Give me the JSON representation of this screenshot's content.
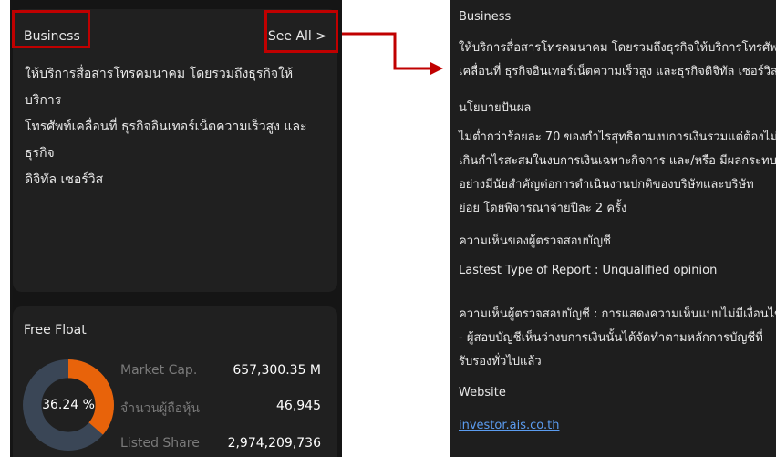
{
  "left": {
    "business": {
      "title": "Business",
      "see_all": "See All >",
      "description_lines": [
        "ให้บริการสื่อสารโทรคมนาคม โดยรวมถึงธุรกิจให้บริการ",
        "โทรศัพท์เคลื่อนที่ ธุรกิจอินเทอร์เน็ตความเร็วสูง และธุรกิจ",
        "ดิจิทัล เซอร์วิส"
      ]
    },
    "free_float": {
      "title": "Free Float",
      "percent_label": "36.24 %",
      "percent_value": 36.24,
      "stats": [
        {
          "label": "Market Cap.",
          "value": "657,300.35 M"
        },
        {
          "label": "จำนวนผู้ถือหุ้น",
          "value": "46,945"
        },
        {
          "label": "Listed Share",
          "value": "2,974,209,736"
        }
      ]
    }
  },
  "right": {
    "business_heading": "Business",
    "business_lines": [
      "ให้บริการสื่อสารโทรคมนาคม โดยรวมถึงธุรกิจให้บริการโทรศัพท์",
      "เคลื่อนที่ ธุรกิจอินเทอร์เน็ตความเร็วสูง และธุรกิจดิจิทัล เซอร์วิส"
    ],
    "dividend_heading": "นโยบายปันผล",
    "dividend_lines": [
      "ไม่ต่ำกว่าร้อยละ 70 ของกำไรสุทธิตามงบการเงินรวมแต่ต้องไม่",
      "เกินกำไรสะสมในงบการเงินเฉพาะกิจการ และ/หรือ มีผลกระทบ",
      "อย่างมีนัยสำคัญต่อการดำเนินงานปกติของบริษัทและบริษัท",
      "ย่อย โดยพิจารณาจ่ายปีละ 2 ครั้ง"
    ],
    "auditor_heading": "ความเห็นของผู้ตรวจสอบบัญชี",
    "report_type": "Lastest Type of Report : Unqualified opinion",
    "opinion_lines": [
      "ความเห็นผู้ตรวจสอบบัญชี : การแสดงความเห็นแบบไม่มีเงื่อนไข",
      "- ผู้สอบบัญชีเห็นว่างบการเงินนั้นได้จัดทำตามหลักการบัญชีที่",
      "รับรองทั่วไปแล้ว"
    ],
    "website_heading": "Website",
    "website_link": "investor.ais.co.th"
  },
  "colors": {
    "highlight": "#c00000",
    "donut_fill": "#e8630a",
    "donut_track": "#3a4656",
    "link": "#5b9cf0"
  }
}
